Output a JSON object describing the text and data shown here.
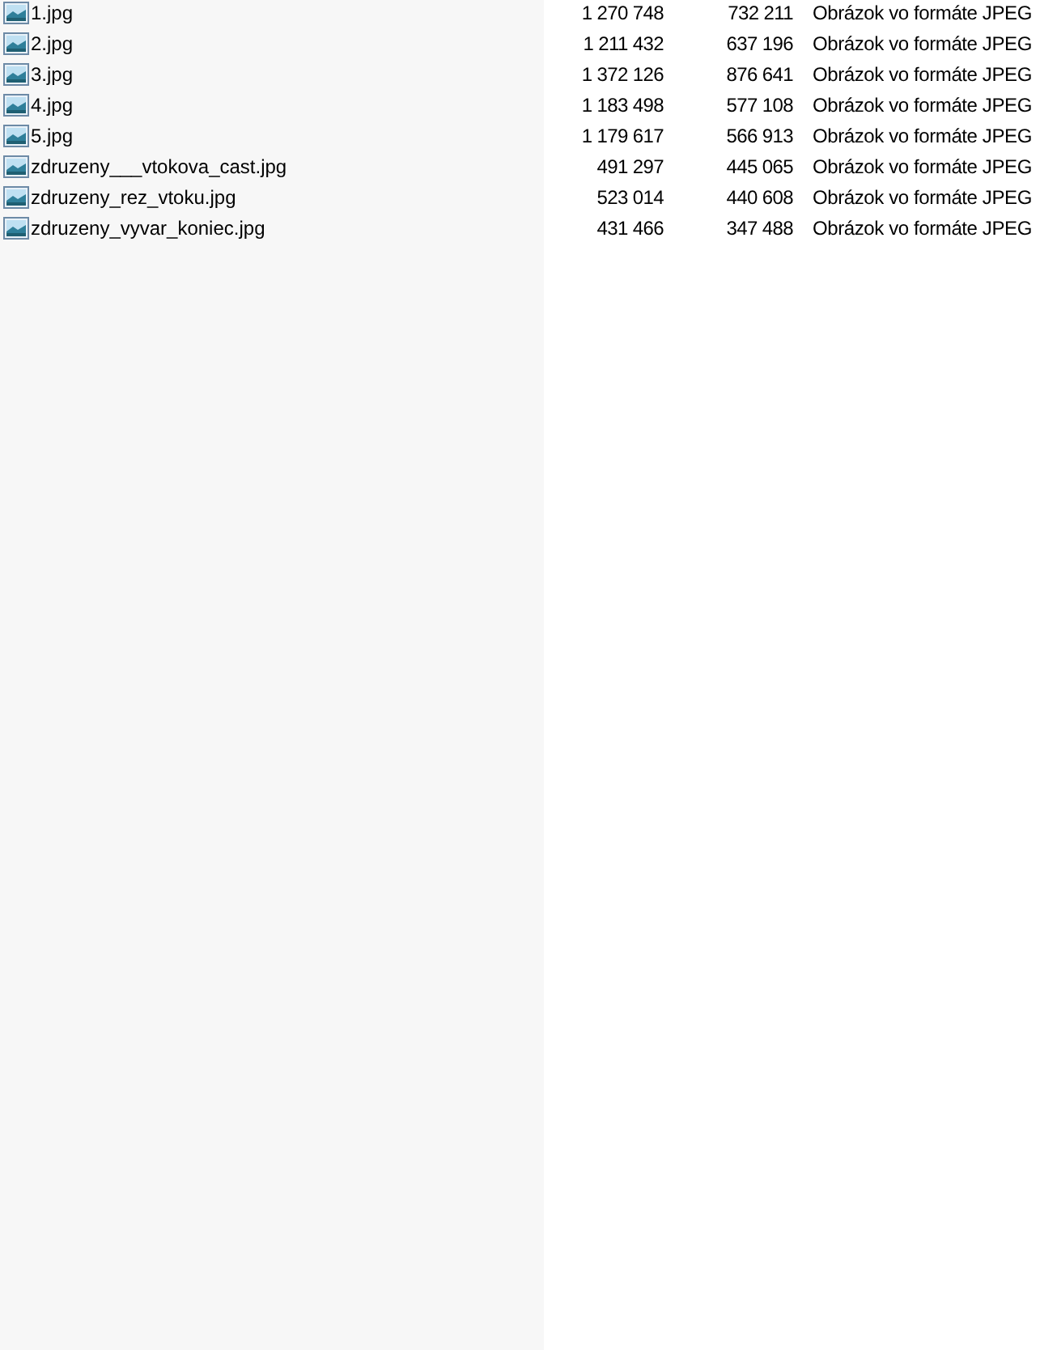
{
  "files": [
    {
      "name": "1.jpg",
      "size": "1 270 748",
      "packed": "732 211",
      "type": "Obrázok vo formáte JPEG"
    },
    {
      "name": "2.jpg",
      "size": "1 211 432",
      "packed": "637 196",
      "type": "Obrázok vo formáte JPEG"
    },
    {
      "name": "3.jpg",
      "size": "1 372 126",
      "packed": "876 641",
      "type": "Obrázok vo formáte JPEG"
    },
    {
      "name": "4.jpg",
      "size": "1 183 498",
      "packed": "577 108",
      "type": "Obrázok vo formáte JPEG"
    },
    {
      "name": "5.jpg",
      "size": "1 179 617",
      "packed": "566 913",
      "type": "Obrázok vo formáte JPEG"
    },
    {
      "name": "zdruzeny___vtokova_cast.jpg",
      "size": "491 297",
      "packed": "445 065",
      "type": "Obrázok vo formáte JPEG"
    },
    {
      "name": "zdruzeny_rez_vtoku.jpg",
      "size": "523 014",
      "packed": "440 608",
      "type": "Obrázok vo formáte JPEG"
    },
    {
      "name": "zdruzeny_vyvar_koniec.jpg",
      "size": "431 466",
      "packed": "347 488",
      "type": "Obrázok vo formáte JPEG"
    }
  ]
}
